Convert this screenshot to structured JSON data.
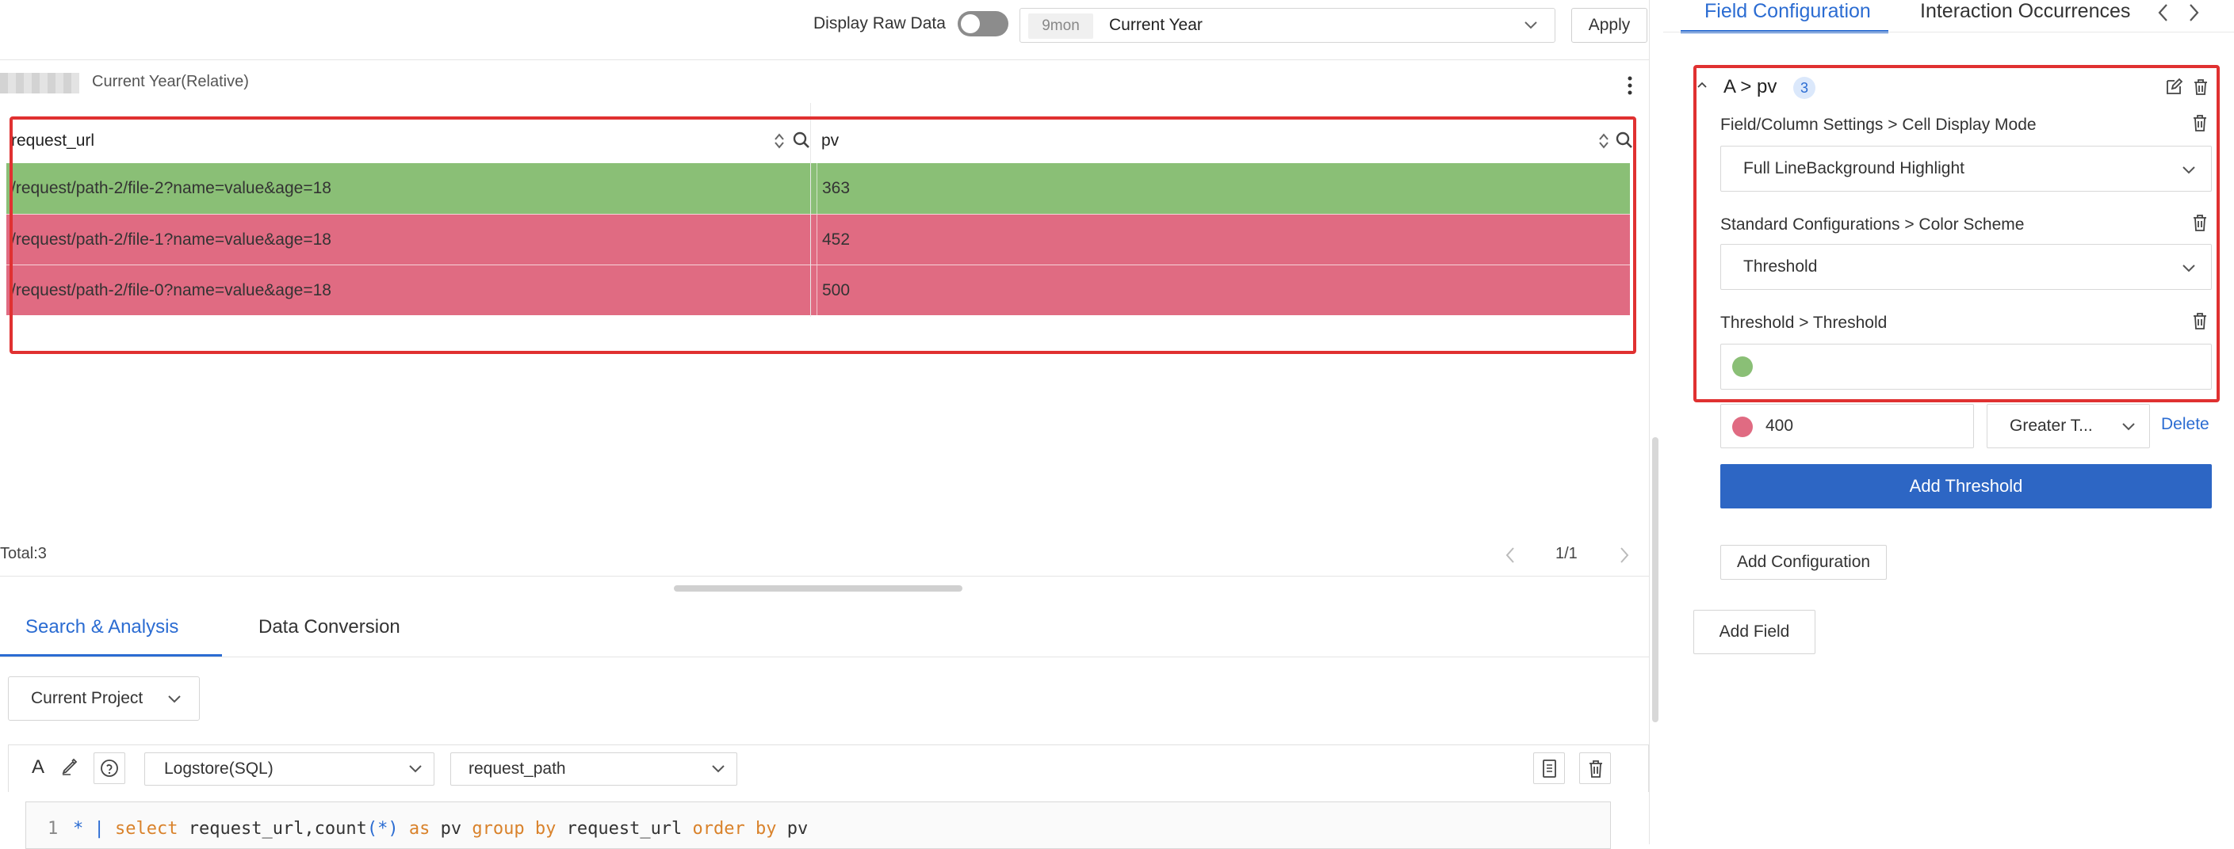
{
  "toolbar": {
    "raw_data_label": "Display Raw Data",
    "raw_data_enabled": false,
    "time_tag": "9mon",
    "time_value": "Current Year",
    "apply_label": "Apply"
  },
  "chart": {
    "subtitle": "Current Year(Relative)",
    "columns": [
      "request_url",
      "pv"
    ],
    "rows": [
      {
        "request_url": "/request/path-2/file-2?name=value&age=18",
        "pv": "363",
        "color": "#8abf76"
      },
      {
        "request_url": "/request/path-2/file-1?name=value&age=18",
        "pv": "452",
        "color": "#e06b82"
      },
      {
        "request_url": "/request/path-2/file-0?name=value&age=18",
        "pv": "500",
        "color": "#e06b82"
      }
    ],
    "total": "Total:3",
    "page_indicator": "1/1"
  },
  "query": {
    "tabs": [
      {
        "label": "Search & Analysis"
      },
      {
        "label": "Data Conversion"
      }
    ],
    "project": "Current Project",
    "logstore_mode": "Logstore(SQL)",
    "logstore_name": "request_path",
    "line_number": "1",
    "code": {
      "star": "*",
      "pipe": "|",
      "select": "select",
      "fields": " request_url,count",
      "paren_open": "(",
      "paren_star": "*",
      "paren_close": ")",
      "as": "as",
      "pv": " pv ",
      "group_by": "group by",
      "group_field": " request_url ",
      "order_by": "order by",
      "order_field": " pv"
    }
  },
  "panel": {
    "tabs": [
      {
        "label": "Field Configuration"
      },
      {
        "label": "Interaction Occurrences"
      }
    ],
    "config_title": "A > pv",
    "config_count": "3",
    "cell_mode_label": "Field/Column Settings > Cell Display Mode",
    "cell_mode_value": "Full LineBackground Highlight",
    "color_scheme_label": "Standard Configurations > Color Scheme",
    "color_scheme_value": "Threshold",
    "threshold_label": "Threshold > Threshold",
    "threshold_base_color": "#8abf76",
    "threshold_color": "#e06b82",
    "threshold_value": "400",
    "threshold_compare": "Greater T...",
    "delete_label": "Delete",
    "add_threshold_label": "Add Threshold",
    "add_config_label": "Add Configuration",
    "add_field_label": "Add Field"
  },
  "colors": {
    "accent": "#2b6cd2",
    "highlight_box": "#e03131"
  }
}
